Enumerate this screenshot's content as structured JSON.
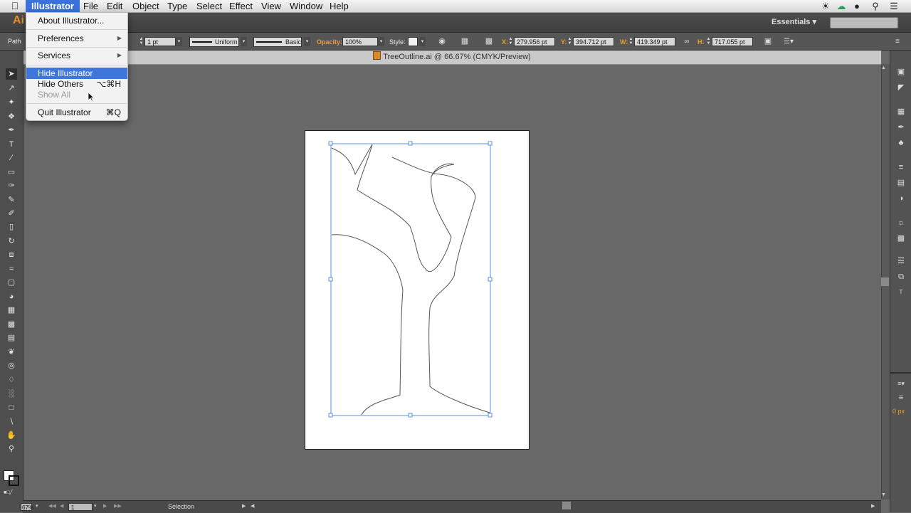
{
  "menubar": {
    "items": [
      "Illustrator",
      "File",
      "Edit",
      "Object",
      "Type",
      "Select",
      "Effect",
      "View",
      "Window",
      "Help"
    ],
    "active": "Illustrator",
    "status_icons": [
      "brightness-icon",
      "creative-cloud-icon",
      "user-icon",
      "spotlight-icon",
      "list-icon"
    ]
  },
  "appbar": {
    "logo": "Ai",
    "workspace": "Essentials"
  },
  "control_bar": {
    "selection_type": "Path",
    "stroke_weight": "1 pt",
    "profile": "Uniform",
    "brush": "Basic",
    "opacity_label": "Opacity:",
    "opacity_value": "100%",
    "style_label": "Style:",
    "x_label": "X:",
    "x_value": "279.956 pt",
    "y_label": "Y:",
    "y_value": "394.712 pt",
    "w_label": "W:",
    "w_value": "419.349 pt",
    "h_label": "H:",
    "h_value": "717.055 pt"
  },
  "document": {
    "title": "TreeOutline.ai @ 66.67% (CMYK/Preview)"
  },
  "status_bar": {
    "zoom": "67%",
    "page": "1",
    "tool": "Selection"
  },
  "right_panel": {
    "unit_value": "0 px"
  },
  "illustrator_menu": {
    "items": [
      {
        "label": "About Illustrator...",
        "shortcut": "",
        "submenu": false,
        "state": "normal"
      },
      {
        "label": "Preferences",
        "shortcut": "",
        "submenu": true,
        "state": "normal"
      },
      {
        "label": "Services",
        "shortcut": "",
        "submenu": true,
        "state": "normal"
      },
      {
        "label": "Hide Illustrator",
        "shortcut": "",
        "submenu": false,
        "state": "highlighted"
      },
      {
        "label": "Hide Others",
        "shortcut": "⌥⌘H",
        "submenu": false,
        "state": "normal"
      },
      {
        "label": "Show All",
        "shortcut": "",
        "submenu": false,
        "state": "disabled"
      },
      {
        "label": "Quit Illustrator",
        "shortcut": "⌘Q",
        "submenu": false,
        "state": "normal"
      }
    ]
  },
  "colors": {
    "menu_highlight": "#3f76dc",
    "selection_bounds": "#5b8fe0",
    "app_accent": "#e8902a"
  }
}
